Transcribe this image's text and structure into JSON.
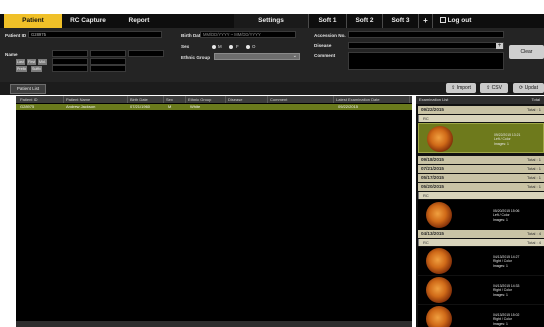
{
  "nav": {
    "tabs": [
      {
        "label": "Patient"
      },
      {
        "label": "RC Capture"
      },
      {
        "label": "Report"
      },
      {
        "label": "Settings"
      },
      {
        "label": "Soft 1"
      },
      {
        "label": "Soft 2"
      },
      {
        "label": "Soft 3"
      },
      {
        "label": "Log out"
      }
    ]
  },
  "form": {
    "patient_id_label": "Patient ID",
    "patient_id_value": "G28975",
    "name_label": "Name",
    "name_chips": [
      "Last",
      "First",
      "Mid."
    ],
    "name_chips2": [
      "Prefix",
      "Suffix"
    ],
    "birth_date_label": "Birth Date",
    "birth_date_value": "MM/DD/YYYY ~ MM/DD/YYYY",
    "sex_label": "Sex",
    "sex_options": [
      "M",
      "F",
      "O"
    ],
    "ethnic_group_label": "Ethnic Group",
    "accession_label": "Accession No.",
    "disease_label": "Disease",
    "comment_label": "Comment",
    "clear_label": "Clear"
  },
  "list": {
    "tab_label": "Patient List",
    "import_label": "Import",
    "csv_label": "CSV",
    "update_label": "Updat",
    "columns": [
      "Patient ID",
      "Patient Name",
      "Birth Date",
      "Sex",
      "Ethnic Group",
      "Disease",
      "Comment",
      "Latest Examination Date"
    ],
    "rows": [
      {
        "id": "G28975",
        "name": "Andrew Jackson",
        "birth": "07/21/1960",
        "sex": "M",
        "ethnic": "White",
        "disease": "",
        "comment": "",
        "latest": "09/22/2015"
      }
    ]
  },
  "exam": {
    "title": "Examination List",
    "total_label": "Total",
    "groups": [
      {
        "date": "09/22/2015",
        "total": "Total : 1",
        "sub": "RC",
        "cards": [
          {
            "time": "09/22/2015 13:21",
            "eye": "Left / Color",
            "images": "Images: 1"
          }
        ]
      },
      {
        "date": "09/18/2015",
        "total": "Total : 1"
      },
      {
        "date": "07/21/2015",
        "total": "Total : 1"
      },
      {
        "date": "05/17/2015",
        "total": "Total : 1"
      },
      {
        "date": "05/20/2015",
        "total": "Total : 1",
        "sub": "RC",
        "cards": [
          {
            "time": "05/20/2015 15:06",
            "eye": "Left / Color",
            "images": "Images: 1"
          }
        ]
      },
      {
        "date": "04/13/2015",
        "total": "Total : 4",
        "sub": "RC",
        "subtotal": "Total : 4",
        "cards": [
          {
            "time": "04/13/2015 14:27",
            "eye": "Right / Color",
            "images": "Images: 1"
          },
          {
            "time": "04/13/2015 14:33",
            "eye": "Right / Color",
            "images": "Images: 1"
          },
          {
            "time": "04/13/2015 15:02",
            "eye": "Right / Color",
            "images": "Images: 1"
          }
        ]
      }
    ]
  }
}
